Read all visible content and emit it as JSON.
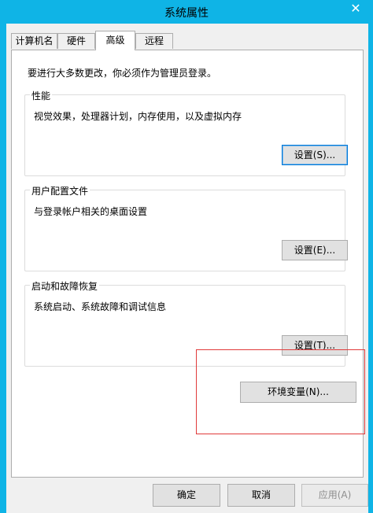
{
  "window": {
    "title": "系统属性",
    "close_glyph": "✕"
  },
  "tabs": [
    {
      "label": "计算机名",
      "active": false
    },
    {
      "label": "硬件",
      "active": false
    },
    {
      "label": "高级",
      "active": true
    },
    {
      "label": "远程",
      "active": false
    }
  ],
  "advanced": {
    "intro": "要进行大多数更改，你必须作为管理员登录。",
    "performance": {
      "title": "性能",
      "description": "视觉效果，处理器计划，内存使用，以及虚拟内存",
      "button": "设置(S)..."
    },
    "user_profiles": {
      "title": "用户配置文件",
      "description": "与登录帐户相关的桌面设置",
      "button": "设置(E)..."
    },
    "startup_recovery": {
      "title": "启动和故障恢复",
      "description": "系统启动、系统故障和调试信息",
      "button": "设置(T)..."
    },
    "env_vars_button": "环境变量(N)..."
  },
  "footer": {
    "ok": "确定",
    "cancel": "取消",
    "apply": "应用(A)"
  },
  "colors": {
    "titlebar": "#0fb4e6",
    "highlight_box": "#e03a3a"
  }
}
